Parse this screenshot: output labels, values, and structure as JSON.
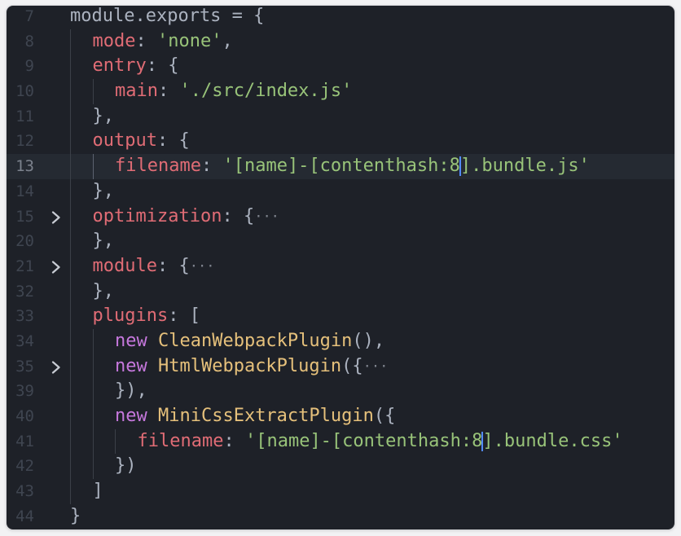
{
  "editor": {
    "lines": [
      {
        "num": "7",
        "fold": false,
        "indent": 0,
        "active": false,
        "tokens": [
          {
            "t": "module.exports = {",
            "c": "plain"
          }
        ]
      },
      {
        "num": "8",
        "fold": false,
        "indent": 1,
        "active": false,
        "tokens": [
          {
            "t": "mode",
            "c": "key"
          },
          {
            "t": ": ",
            "c": "punc"
          },
          {
            "t": "'none'",
            "c": "str"
          },
          {
            "t": ",",
            "c": "punc"
          }
        ]
      },
      {
        "num": "9",
        "fold": false,
        "indent": 1,
        "active": false,
        "tokens": [
          {
            "t": "entry",
            "c": "key"
          },
          {
            "t": ": {",
            "c": "punc"
          }
        ]
      },
      {
        "num": "10",
        "fold": false,
        "indent": 2,
        "active": false,
        "tokens": [
          {
            "t": "main",
            "c": "key"
          },
          {
            "t": ": ",
            "c": "punc"
          },
          {
            "t": "'./src/index.js'",
            "c": "str"
          }
        ]
      },
      {
        "num": "11",
        "fold": false,
        "indent": 1,
        "active": false,
        "tokens": [
          {
            "t": "},",
            "c": "punc"
          }
        ]
      },
      {
        "num": "12",
        "fold": false,
        "indent": 1,
        "active": false,
        "tokens": [
          {
            "t": "output",
            "c": "key"
          },
          {
            "t": ": {",
            "c": "punc"
          }
        ]
      },
      {
        "num": "13",
        "fold": false,
        "indent": 2,
        "active": true,
        "tokens": [
          {
            "t": "filename",
            "c": "key"
          },
          {
            "t": ": ",
            "c": "punc"
          },
          {
            "t": "'[name]-[contenthash:8",
            "c": "str"
          },
          {
            "cursor": true
          },
          {
            "t": "].bundle.js'",
            "c": "str"
          }
        ]
      },
      {
        "num": "14",
        "fold": false,
        "indent": 1,
        "active": false,
        "tokens": [
          {
            "t": "},",
            "c": "punc"
          }
        ]
      },
      {
        "num": "15",
        "fold": true,
        "indent": 1,
        "active": false,
        "tokens": [
          {
            "t": "optimization",
            "c": "key"
          },
          {
            "t": ": {",
            "c": "punc"
          },
          {
            "t": "···",
            "c": "ell"
          }
        ]
      },
      {
        "num": "20",
        "fold": false,
        "indent": 1,
        "active": false,
        "tokens": [
          {
            "t": "},",
            "c": "punc"
          }
        ]
      },
      {
        "num": "21",
        "fold": true,
        "indent": 1,
        "active": false,
        "tokens": [
          {
            "t": "module",
            "c": "key"
          },
          {
            "t": ": {",
            "c": "punc"
          },
          {
            "t": "···",
            "c": "ell"
          }
        ]
      },
      {
        "num": "32",
        "fold": false,
        "indent": 1,
        "active": false,
        "tokens": [
          {
            "t": "},",
            "c": "punc"
          }
        ]
      },
      {
        "num": "33",
        "fold": false,
        "indent": 1,
        "active": false,
        "tokens": [
          {
            "t": "plugins",
            "c": "key"
          },
          {
            "t": ": [",
            "c": "punc"
          }
        ]
      },
      {
        "num": "34",
        "fold": false,
        "indent": 2,
        "active": false,
        "tokens": [
          {
            "t": "new ",
            "c": "new"
          },
          {
            "t": "CleanWebpackPlugin",
            "c": "cls"
          },
          {
            "t": "(),",
            "c": "punc"
          }
        ]
      },
      {
        "num": "35",
        "fold": true,
        "indent": 2,
        "active": false,
        "tokens": [
          {
            "t": "new ",
            "c": "new"
          },
          {
            "t": "HtmlWebpackPlugin",
            "c": "cls"
          },
          {
            "t": "({",
            "c": "punc"
          },
          {
            "t": "···",
            "c": "ell"
          }
        ]
      },
      {
        "num": "39",
        "fold": false,
        "indent": 2,
        "active": false,
        "tokens": [
          {
            "t": "}),",
            "c": "punc"
          }
        ]
      },
      {
        "num": "40",
        "fold": false,
        "indent": 2,
        "active": false,
        "tokens": [
          {
            "t": "new ",
            "c": "new"
          },
          {
            "t": "MiniCssExtractPlugin",
            "c": "cls"
          },
          {
            "t": "({",
            "c": "punc"
          }
        ]
      },
      {
        "num": "41",
        "fold": false,
        "indent": 3,
        "active": false,
        "tokens": [
          {
            "t": "filename",
            "c": "key"
          },
          {
            "t": ": ",
            "c": "punc"
          },
          {
            "t": "'[name]-[contenthash:8",
            "c": "str"
          },
          {
            "cursor": true
          },
          {
            "t": "].bundle.css'",
            "c": "str"
          }
        ]
      },
      {
        "num": "42",
        "fold": false,
        "indent": 2,
        "active": false,
        "tokens": [
          {
            "t": "})",
            "c": "punc"
          }
        ]
      },
      {
        "num": "43",
        "fold": false,
        "indent": 1,
        "active": false,
        "tokens": [
          {
            "t": "]",
            "c": "punc"
          }
        ]
      },
      {
        "num": "44",
        "fold": false,
        "indent": 0,
        "active": false,
        "tokens": [
          {
            "t": "}",
            "c": "punc"
          }
        ]
      }
    ]
  },
  "icons": {
    "fold": "chevron-right-icon"
  },
  "colors": {
    "background": "#1e2128",
    "key": "#e06c75",
    "string": "#98c379",
    "keyword": "#c678dd",
    "class": "#e5c07b",
    "cursor": "#528bff"
  }
}
